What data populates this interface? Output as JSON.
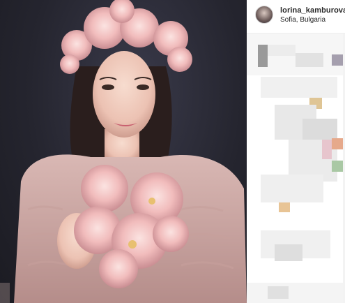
{
  "post": {
    "username": "lorina_kamburova",
    "location": "Sofia, Bulgaria"
  },
  "icons": {
    "avatar": "profile-avatar",
    "photo": "post-photo"
  },
  "colors": {
    "photo_background": "#25252f",
    "text": "#262626",
    "panel_background": "#ffffff"
  }
}
